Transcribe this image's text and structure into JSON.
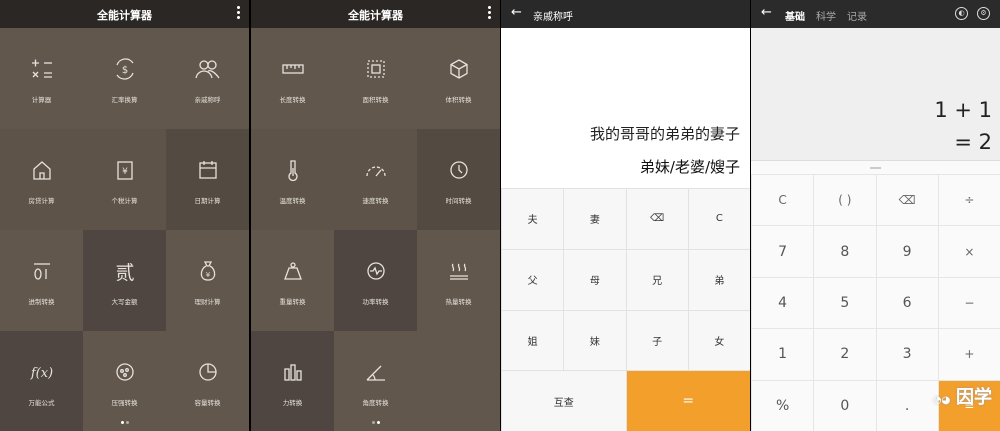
{
  "panel1": {
    "title": "全能计算器",
    "tiles": [
      {
        "label": "计算器",
        "icon": "calculator-icon",
        "shade": "#61574c"
      },
      {
        "label": "汇率换算",
        "icon": "currency-exchange-icon",
        "shade": "#61574c"
      },
      {
        "label": "亲戚称呼",
        "icon": "relatives-icon",
        "shade": "#61574c"
      },
      {
        "label": "房贷计算",
        "icon": "house-icon",
        "shade": "#5d5348"
      },
      {
        "label": "个税计算",
        "icon": "tax-icon",
        "shade": "#5d5348"
      },
      {
        "label": "日期计算",
        "icon": "calendar-icon",
        "shade": "#534a42"
      },
      {
        "label": "进制转换",
        "icon": "binary-icon",
        "shade": "#61574c"
      },
      {
        "label": "大写金额",
        "icon": "capital-amount-icon",
        "shade": "#4f4641"
      },
      {
        "label": "理财计算",
        "icon": "money-bag-icon",
        "shade": "#61574c"
      },
      {
        "label": "万能公式",
        "icon": "formula-icon",
        "shade": "#4f4641"
      },
      {
        "label": "压强转换",
        "icon": "pressure-icon",
        "shade": "#61574c"
      },
      {
        "label": "容量转换",
        "icon": "pie-chart-icon",
        "shade": "#61574c"
      }
    ]
  },
  "panel2": {
    "title": "全能计算器",
    "tiles": [
      {
        "label": "长度转换",
        "icon": "ruler-icon",
        "shade": "#61574c"
      },
      {
        "label": "面积转换",
        "icon": "area-icon",
        "shade": "#61574c"
      },
      {
        "label": "体积转换",
        "icon": "cube-icon",
        "shade": "#61574c"
      },
      {
        "label": "温度转换",
        "icon": "thermometer-icon",
        "shade": "#5d5348"
      },
      {
        "label": "速度转换",
        "icon": "speedometer-icon",
        "shade": "#5d5348"
      },
      {
        "label": "时间转换",
        "icon": "clock-icon",
        "shade": "#534a42"
      },
      {
        "label": "重量转换",
        "icon": "weight-icon",
        "shade": "#61574c"
      },
      {
        "label": "功率转换",
        "icon": "power-icon",
        "shade": "#4f4641"
      },
      {
        "label": "热量转换",
        "icon": "heat-icon",
        "shade": "#61574c"
      },
      {
        "label": "力转换",
        "icon": "force-icon",
        "shade": "#4f4641"
      },
      {
        "label": "角度转换",
        "icon": "angle-icon",
        "shade": "#61574c"
      },
      {
        "label": "",
        "icon": "",
        "shade": "#61574c"
      }
    ]
  },
  "panel3": {
    "title": "亲戚称呼",
    "back_icon": "arrow-left-icon",
    "expression": "我的哥哥的弟弟的妻子",
    "result": "弟妹/老婆/嫂子",
    "keys": [
      {
        "label": "夫"
      },
      {
        "label": "妻"
      },
      {
        "label": "⌫"
      },
      {
        "label": "C"
      },
      {
        "label": "父"
      },
      {
        "label": "母"
      },
      {
        "label": "兄"
      },
      {
        "label": "弟"
      },
      {
        "label": "姐"
      },
      {
        "label": "妹"
      },
      {
        "label": "子"
      },
      {
        "label": "女"
      },
      {
        "label": "互查"
      },
      {
        "label": "="
      }
    ]
  },
  "panel4": {
    "back_icon": "arrow-left-icon",
    "tabs": [
      "基础",
      "科学",
      "记录"
    ],
    "active_tab": "基础",
    "expression": "1 + 1",
    "result": "= 2",
    "keys": [
      {
        "label": "C"
      },
      {
        "label": "( )"
      },
      {
        "label": "⌫"
      },
      {
        "label": "÷"
      },
      {
        "label": "7"
      },
      {
        "label": "8"
      },
      {
        "label": "9"
      },
      {
        "label": "×"
      },
      {
        "label": "4"
      },
      {
        "label": "5"
      },
      {
        "label": "6"
      },
      {
        "label": "−"
      },
      {
        "label": "1"
      },
      {
        "label": "2"
      },
      {
        "label": "3"
      },
      {
        "label": "+"
      },
      {
        "label": "%"
      },
      {
        "label": "0"
      },
      {
        "label": "."
      },
      {
        "label": "="
      }
    ],
    "watermark": "因学"
  },
  "accent": "#f39f2c"
}
